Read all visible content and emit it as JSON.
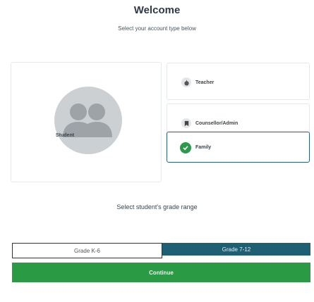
{
  "header": {
    "title": "Welcome",
    "subtitle": "Select your account type below"
  },
  "student": {
    "label": "Student",
    "avatar_icon": "two-people-silhouette"
  },
  "options": {
    "teacher": {
      "label": "Teacher",
      "icon": "apple-icon"
    },
    "counsellor": {
      "label": "Counsellor/Admin",
      "icon": "bookmark-icon"
    },
    "family": {
      "label": "Family",
      "icon": "check-icon",
      "selected": true
    }
  },
  "grade": {
    "heading": "Select student's grade range",
    "left_label": "Grade K-6",
    "right_label": "Grade 7-12"
  },
  "actions": {
    "continue_label": "Continue"
  },
  "colors": {
    "primary_green": "#2a9a45",
    "dark_teal": "#1f5f74",
    "avatar_gray": "#cdd0d3"
  }
}
